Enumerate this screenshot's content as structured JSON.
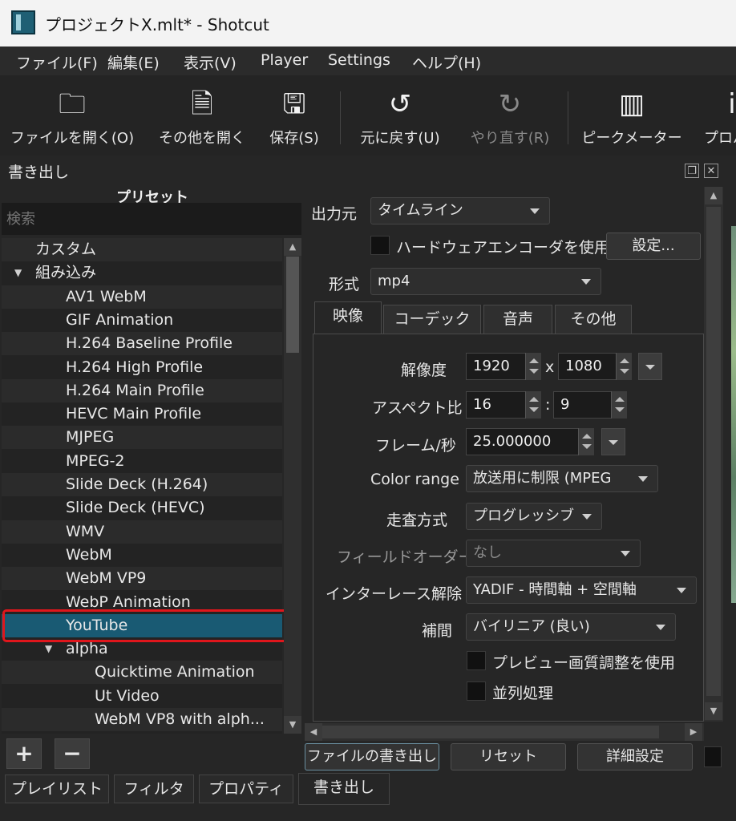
{
  "window": {
    "title": "プロジェクトX.mlt* - Shotcut"
  },
  "menu": [
    "ファイル(F)",
    "編集(E)",
    "表示(V)",
    "Player",
    "Settings",
    "ヘルプ(H)"
  ],
  "toolbar": {
    "open_file": "ファイルを開く(O)",
    "open_other": "その他を開く",
    "save": "保存(S)",
    "undo": "元に戻す(U)",
    "redo": "やり直す(R)",
    "peak_meter": "ピークメーター",
    "properties": "プロパ"
  },
  "panel": {
    "title": "書き出し"
  },
  "presets": {
    "header": "プリセット",
    "search_placeholder": "検索",
    "items": [
      {
        "label": "カスタム",
        "level": 0
      },
      {
        "label": "組み込み",
        "level": 0,
        "expanded": true
      },
      {
        "label": "AV1 WebM",
        "level": 1
      },
      {
        "label": "GIF Animation",
        "level": 1
      },
      {
        "label": "H.264 Baseline Profile",
        "level": 1
      },
      {
        "label": "H.264 High Profile",
        "level": 1
      },
      {
        "label": "H.264 Main Profile",
        "level": 1
      },
      {
        "label": "HEVC Main Profile",
        "level": 1
      },
      {
        "label": "MJPEG",
        "level": 1
      },
      {
        "label": "MPEG-2",
        "level": 1
      },
      {
        "label": "Slide Deck (H.264)",
        "level": 1
      },
      {
        "label": "Slide Deck (HEVC)",
        "level": 1
      },
      {
        "label": "WMV",
        "level": 1
      },
      {
        "label": "WebM",
        "level": 1
      },
      {
        "label": "WebM VP9",
        "level": 1
      },
      {
        "label": "WebP Animation",
        "level": 1
      },
      {
        "label": "YouTube",
        "level": 1,
        "selected": true
      },
      {
        "label": "alpha",
        "level": 1,
        "expanded": true
      },
      {
        "label": "Quicktime Animation",
        "level": 2
      },
      {
        "label": "Ut Video",
        "level": 2
      },
      {
        "label": "WebM VP8 with alph...",
        "level": 2
      }
    ],
    "add_label": "+",
    "remove_label": "−"
  },
  "form": {
    "source_label": "出力元",
    "source_value": "タイムライン",
    "hw_encoder_label": "ハードウェアエンコーダを使用",
    "hw_settings_button": "設定...",
    "format_label": "形式",
    "format_value": "mp4",
    "tabs": [
      "映像",
      "コーデック",
      "音声",
      "その他"
    ],
    "resolution_label": "解像度",
    "width": "1920",
    "x_sep": "x",
    "height": "1080",
    "aspect_label": "アスペクト比",
    "aspect_num": "16",
    "colon": ":",
    "aspect_den": "9",
    "fps_label": "フレーム/秒",
    "fps_value": "25.000000",
    "color_range_label": "Color range",
    "color_range_value": "放送用に制限 (MPEG",
    "scan_label": "走査方式",
    "scan_value": "プログレッシブ",
    "field_order_label": "フィールドオーダー",
    "field_order_value": "なし",
    "deinterlace_label": "インターレース解除",
    "deinterlace_value": "YADIF - 時間軸 + 空間軸",
    "interp_label": "補間",
    "interp_value": "バイリニア (良い)",
    "preview_scaling_label": "プレビュー画質調整を使用",
    "parallel_label": "並列処理"
  },
  "actions": {
    "export_file": "ファイルの書き出し",
    "reset": "リセット",
    "advanced": "詳細設定"
  },
  "bottom_tabs": [
    "プレイリスト",
    "フィルタ",
    "プロパティ",
    "書き出し"
  ],
  "colors": {
    "selection": "#195a73",
    "highlight_box": "#e0161c"
  }
}
